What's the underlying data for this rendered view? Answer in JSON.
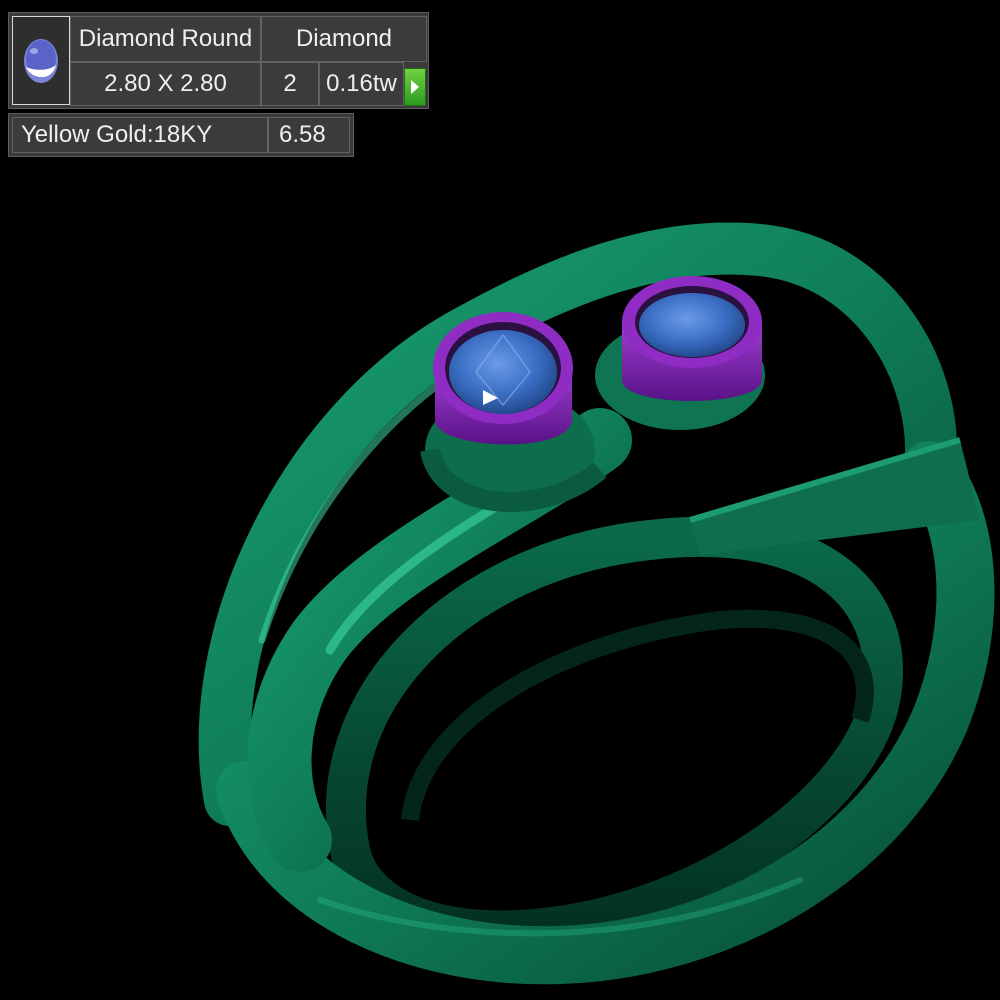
{
  "stone_panel": {
    "thumbnail_icon": "round-gem-icon",
    "shape_label": "Diamond Round",
    "type_label": "Diamond",
    "size_label": "2.80 X 2.80",
    "count": "2",
    "weight": "0.16tw",
    "go_icon": "play-arrow-icon",
    "go_button_color": "#3fb42a"
  },
  "metal_panel": {
    "metal_label": "Yellow Gold:18KY",
    "weight": "6.58"
  },
  "viewport": {
    "ring_color": "#0f7a56",
    "bezel_color": "#7c1fae",
    "stone_color": "#3d73c8",
    "background": "#000000"
  }
}
